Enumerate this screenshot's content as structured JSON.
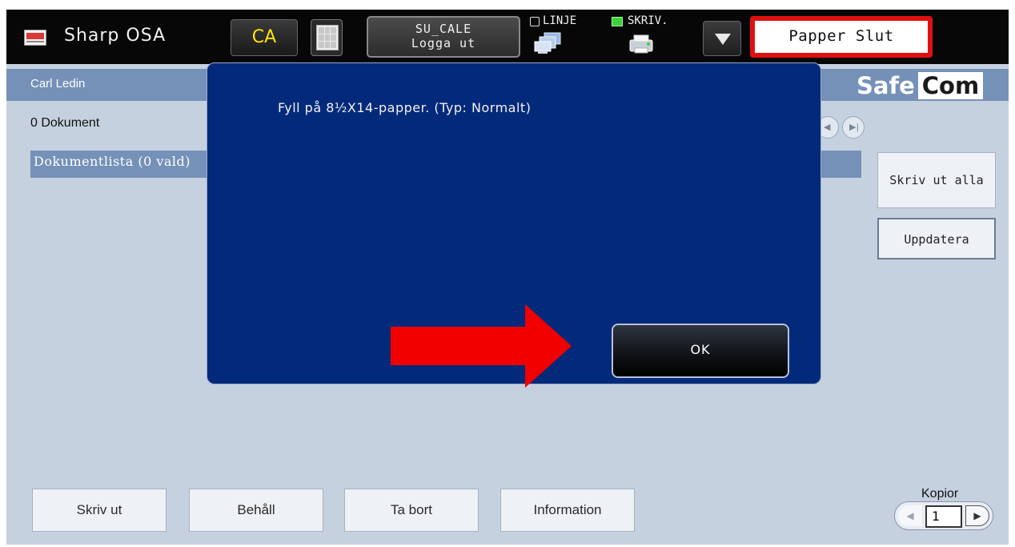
{
  "topbar": {
    "app_title": "Sharp OSA",
    "ca_label": "CA",
    "user_line1": "SU_CALE",
    "user_line2": "Logga ut",
    "line_label": "LINJE",
    "print_label": "SKRIV.",
    "alert_label": "Papper Slut",
    "alert_color": "#e01010"
  },
  "header": {
    "user_name": "Carl Ledin",
    "logo_safe": "Safe",
    "logo_com": "Com"
  },
  "main": {
    "doc_count": "0 Dokument",
    "list_header": "Dokumentlista (0 vald)",
    "print_all_label": "Skriv ut alla",
    "refresh_label": "Uppdatera"
  },
  "bottom": {
    "print_label": "Skriv ut",
    "keep_label": "Behåll",
    "delete_label": "Ta bort",
    "info_label": "Information"
  },
  "copies": {
    "label": "Kopior",
    "value": "1"
  },
  "modal": {
    "message": "Fyll på 8½X14-papper. (Typ: Normalt)",
    "ok_label": "OK",
    "background": "#032a7a"
  },
  "annotation": {
    "arrow_color": "#f20000"
  }
}
